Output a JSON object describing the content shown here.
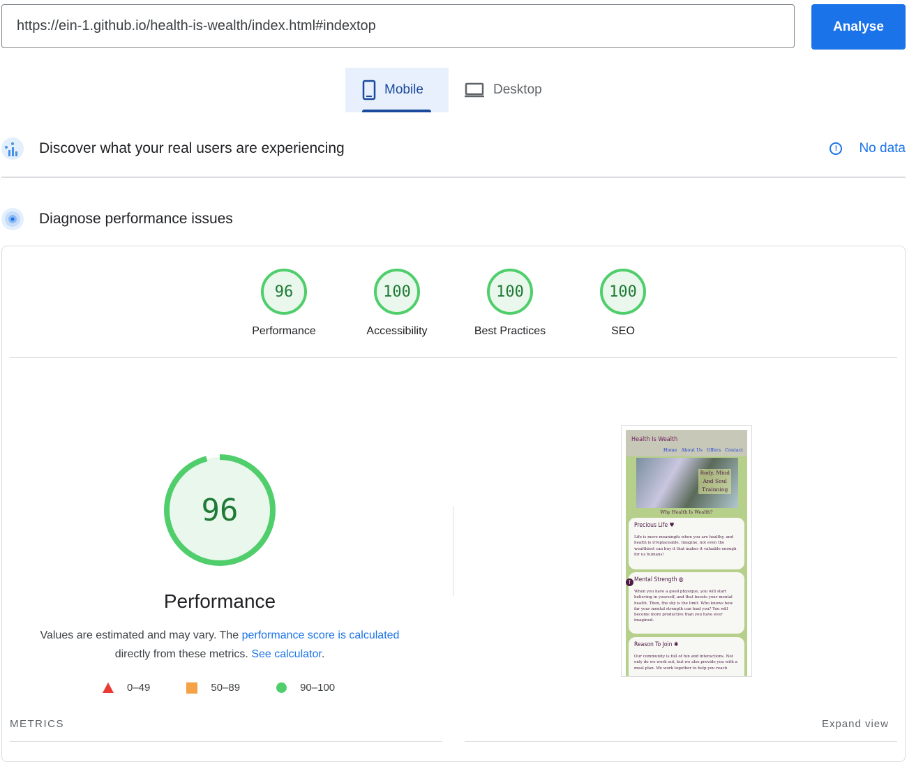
{
  "url_bar": {
    "value": "https://ein-1.github.io/health-is-wealth/index.html#indextop"
  },
  "analyse_button": {
    "label": "Analyse"
  },
  "device_tabs": {
    "mobile": "Mobile",
    "desktop": "Desktop"
  },
  "crux_section": {
    "title": "Discover what your real users are experiencing",
    "status": "No data"
  },
  "diagnose_section": {
    "title": "Diagnose performance issues"
  },
  "scores": [
    {
      "label": "Performance",
      "value": "96"
    },
    {
      "label": "Accessibility",
      "value": "100"
    },
    {
      "label": "Best Practices",
      "value": "100"
    },
    {
      "label": "SEO",
      "value": "100"
    }
  ],
  "performance_detail": {
    "score": "96",
    "score_fraction": 0.96,
    "title": "Performance",
    "desc_prefix": "Values are estimated and may vary. The ",
    "link_score": "performance score is calculated",
    "desc_middle": " directly from these metrics. ",
    "link_calc": "See calculator",
    "desc_suffix": "."
  },
  "legend": {
    "fail": "0–49",
    "average": "50–89",
    "pass": "90–100"
  },
  "metrics_section": {
    "label": "METRICS",
    "expand": "Expand view"
  },
  "screenshot": {
    "brand": "Health Is Wealth",
    "nav": [
      "Home",
      "About Us",
      "Offers",
      "Contact"
    ],
    "hero_text_1": "Body, Mind",
    "hero_text_2": "And Soul",
    "hero_text_3": "Trainning",
    "why": "Why Health Is Wealth?",
    "card1_title": "Precious Life",
    "card1_text": "Life is more meaningfu when you are healthy, and health is irreplaceable. Imagine, not even the wealthiest can buy it that makes it valuable enough for us humans!",
    "card2_title": "Mental Strength",
    "card2_text": "When you have a good physique, you will start believing in yourself, and that boosts your mental health. Then, the sky is the limit. Who knows how far your mental strength can lead you? You will become more productive than you have ever imagined.",
    "card3_title": "Reason To Join",
    "card3_text": "Our community is full of fun and interactions. Not only do we work out, but we also provide you with a meal plan. We work together to help you reach"
  },
  "colors": {
    "accent": "#1a73e8",
    "pass": "#4fce6b",
    "average": "#f5a146",
    "fail": "#eb3a34"
  }
}
